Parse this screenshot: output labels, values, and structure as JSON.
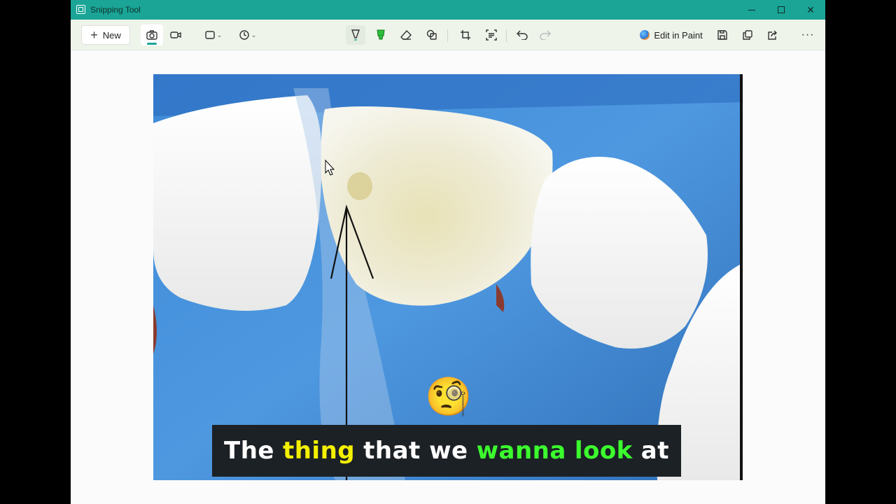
{
  "window": {
    "title": "Snipping Tool"
  },
  "window_controls": {
    "minimize": "minimize-icon",
    "maximize": "maximize-icon",
    "close": "close-icon"
  },
  "toolbar": {
    "new_label": "New",
    "edit_in_paint_label": "Edit in Paint",
    "tools": [
      "camera-icon",
      "video-icon",
      "rectangle-mode-icon",
      "timer-icon",
      "ballpoint-pen-icon",
      "highlighter-icon",
      "eraser-icon",
      "shapes-icon",
      "crop-icon",
      "text-actions-icon",
      "undo-icon",
      "redo-icon",
      "paint-icon",
      "save-icon",
      "copy-icon",
      "share-icon",
      "more-icon"
    ]
  },
  "colors": {
    "titlebar": "#1aa596",
    "highlight_yellow": "#f3f000",
    "highlight_green": "#3cff2e",
    "caption_bg": "#1c2126"
  },
  "caption": {
    "words": [
      "The",
      "thing",
      "that we",
      "wanna",
      "look",
      "at"
    ]
  },
  "emoji": "🧐"
}
